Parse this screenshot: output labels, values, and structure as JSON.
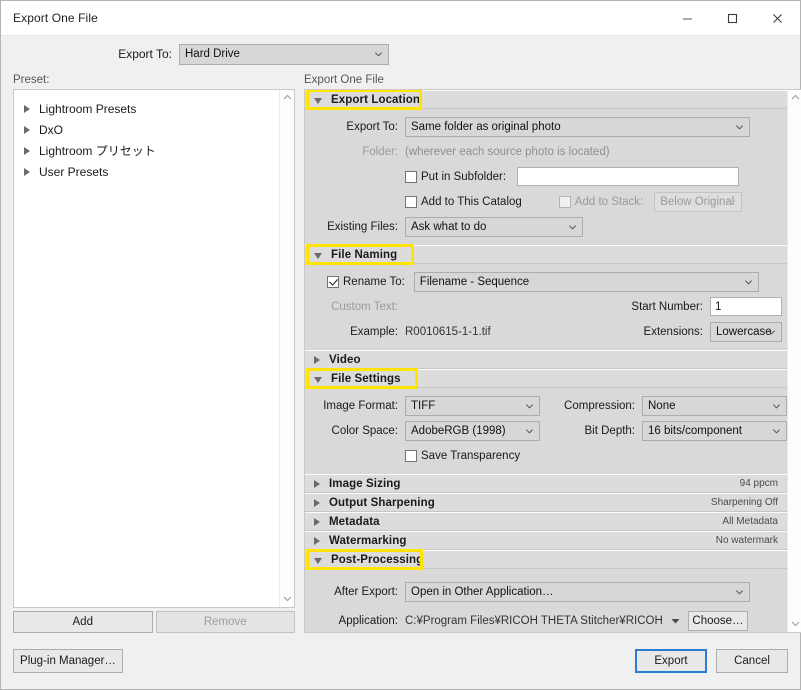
{
  "window": {
    "title": "Export One File",
    "controls": {
      "minimize": "minimize-button",
      "maximize": "maximize-button",
      "close": "close-button"
    }
  },
  "topbar": {
    "export_to_label": "Export To:",
    "export_to_value": "Hard Drive"
  },
  "left": {
    "caption": "Preset:",
    "items": [
      {
        "label": "Lightroom Presets",
        "expanded": false
      },
      {
        "label": "DxO",
        "expanded": false
      },
      {
        "label": "Lightroom プリセット",
        "expanded": false
      },
      {
        "label": "User Presets",
        "expanded": false
      }
    ],
    "add_label": "Add",
    "remove_label": "Remove",
    "remove_disabled": true
  },
  "right": {
    "caption": "Export One File",
    "sections": [
      {
        "id": "export-location",
        "title": "Export Location",
        "expanded": true,
        "highlighted": true,
        "summary": ""
      },
      {
        "id": "file-naming",
        "title": "File Naming",
        "expanded": true,
        "highlighted": true,
        "summary": ""
      },
      {
        "id": "video",
        "title": "Video",
        "expanded": false,
        "highlighted": false,
        "summary": ""
      },
      {
        "id": "file-settings",
        "title": "File Settings",
        "expanded": true,
        "highlighted": true,
        "summary": ""
      },
      {
        "id": "image-sizing",
        "title": "Image Sizing",
        "expanded": false,
        "highlighted": false,
        "summary": "94 ppcm"
      },
      {
        "id": "output-sharpening",
        "title": "Output Sharpening",
        "expanded": false,
        "highlighted": false,
        "summary": "Sharpening Off"
      },
      {
        "id": "metadata",
        "title": "Metadata",
        "expanded": false,
        "highlighted": false,
        "summary": "All Metadata"
      },
      {
        "id": "watermarking",
        "title": "Watermarking",
        "expanded": false,
        "highlighted": false,
        "summary": "No watermark"
      },
      {
        "id": "post-processing",
        "title": "Post-Processing",
        "expanded": true,
        "highlighted": true,
        "summary": ""
      }
    ],
    "export_location": {
      "export_to_label": "Export To:",
      "export_to_value": "Same folder as original photo",
      "folder_label": "Folder:",
      "folder_value": "(wherever each source photo is located)",
      "put_in_subfolder_label": "Put in Subfolder:",
      "put_in_subfolder_checked": false,
      "subfolder_value": "",
      "add_to_catalog_label": "Add to This Catalog",
      "add_to_catalog_checked": false,
      "add_to_stack_label": "Add to Stack:",
      "add_to_stack_checked": false,
      "stack_position_value": "Below Original",
      "existing_files_label": "Existing Files:",
      "existing_files_value": "Ask what to do"
    },
    "file_naming": {
      "rename_to_label": "Rename To:",
      "rename_to_checked": true,
      "rename_to_value": "Filename - Sequence",
      "custom_text_label": "Custom Text:",
      "custom_text_value": "",
      "start_number_label": "Start Number:",
      "start_number_value": "1",
      "example_label": "Example:",
      "example_value": "R0010615-1-1.tif",
      "extensions_label": "Extensions:",
      "extensions_value": "Lowercase"
    },
    "file_settings": {
      "image_format_label": "Image Format:",
      "image_format_value": "TIFF",
      "compression_label": "Compression:",
      "compression_value": "None",
      "color_space_label": "Color Space:",
      "color_space_value": "AdobeRGB (1998)",
      "bit_depth_label": "Bit Depth:",
      "bit_depth_value": "16 bits/component",
      "save_transparency_label": "Save Transparency",
      "save_transparency_checked": false
    },
    "post_processing": {
      "after_export_label": "After Export:",
      "after_export_value": "Open in Other Application…",
      "application_label": "Application:",
      "application_value": "C:¥Program Files¥RICOH THETA Stitcher¥RICOH THETA Stitcher.exe",
      "choose_label": "Choose…"
    }
  },
  "footer": {
    "plugin_manager_label": "Plug-in Manager…",
    "export_label": "Export",
    "cancel_label": "Cancel"
  },
  "colors": {
    "highlight": "#ffe400",
    "focus_border": "#2b7cd3",
    "panel_bg": "#d9d9d9",
    "section_header_bg": "#dcdcdc"
  }
}
